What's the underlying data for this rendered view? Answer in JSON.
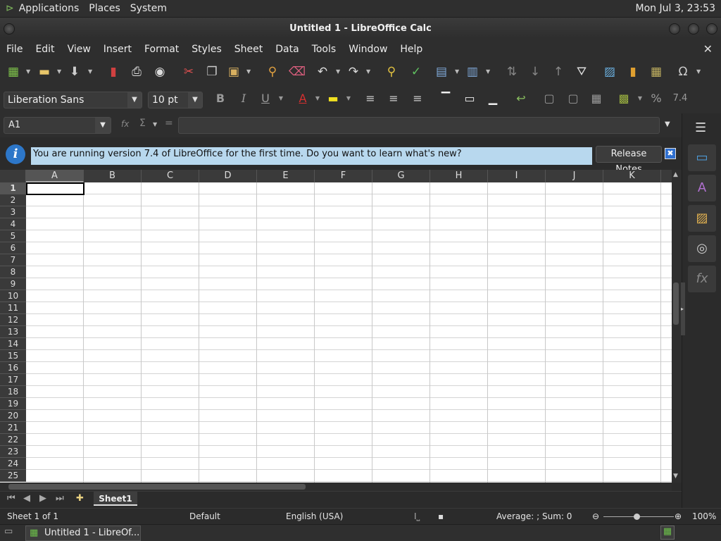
{
  "topbar": {
    "menus": [
      "Applications",
      "Places",
      "System"
    ],
    "clock": "Mon Jul  3, 23:53"
  },
  "window": {
    "title": "Untitled 1 - LibreOffice Calc"
  },
  "menubar": [
    "File",
    "Edit",
    "View",
    "Insert",
    "Format",
    "Styles",
    "Sheet",
    "Data",
    "Tools",
    "Window",
    "Help"
  ],
  "formatting": {
    "font": "Liberation Sans",
    "size": "10 pt"
  },
  "formula": {
    "cell_ref": "A1",
    "content": ""
  },
  "infobar": {
    "message": "You are running version 7.4 of LibreOffice for the first time. Do you want to learn what's new?",
    "button": "Release Notes",
    "close": "✖"
  },
  "columns": [
    "A",
    "B",
    "C",
    "D",
    "E",
    "F",
    "G",
    "H",
    "I",
    "J",
    "K"
  ],
  "rows": [
    "1",
    "2",
    "3",
    "4",
    "5",
    "6",
    "7",
    "8",
    "9",
    "10",
    "11",
    "12",
    "13",
    "14",
    "15",
    "16",
    "17",
    "18",
    "19",
    "20",
    "21",
    "22",
    "23",
    "24",
    "25"
  ],
  "sheets": {
    "active": "Sheet1"
  },
  "status": {
    "sheet": "Sheet 1 of 1",
    "page_style": "Default",
    "language": "English (USA)",
    "summary": "Average: ; Sum: 0",
    "zoom": "100%"
  },
  "taskbar": {
    "item": "Untitled 1 - LibreOf..."
  },
  "colors": {
    "accent": "#2d77c9",
    "info_bg": "#b8d8ee"
  }
}
